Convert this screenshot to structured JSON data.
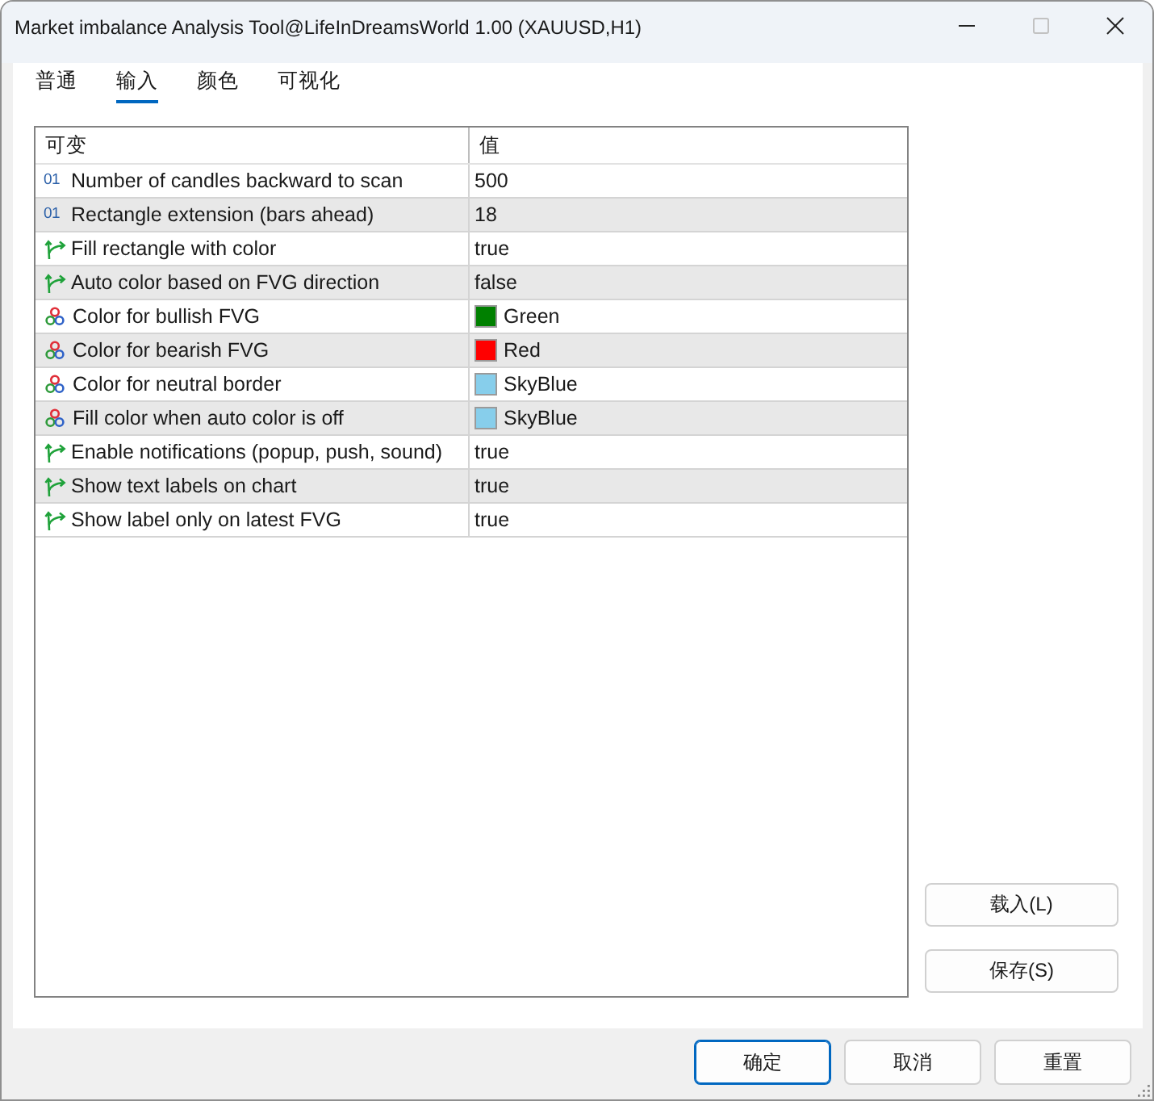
{
  "window": {
    "title": "Market imbalance Analysis Tool@LifeInDreamsWorld 1.00 (XAUUSD,H1)",
    "controls": [
      {
        "kind": "minimize",
        "disabled": false
      },
      {
        "kind": "maximize",
        "disabled": true
      },
      {
        "kind": "close",
        "disabled": false
      }
    ]
  },
  "tabs": [
    {
      "label": "普通",
      "selected": false
    },
    {
      "label": "输入",
      "selected": true
    },
    {
      "label": "颜色",
      "selected": false
    },
    {
      "label": "可视化",
      "selected": false
    }
  ],
  "table": {
    "columns": [
      "可变",
      "值"
    ],
    "rows": [
      {
        "kind": "int",
        "icon_text": "01",
        "name": "Number of candles backward to scan",
        "value": "500"
      },
      {
        "kind": "int",
        "icon_text": "01",
        "name": "Rectangle extension (bars ahead)",
        "value": "18"
      },
      {
        "kind": "bool",
        "name": "Fill rectangle with color",
        "value": "true"
      },
      {
        "kind": "bool",
        "name": "Auto color based on FVG direction",
        "value": "false"
      },
      {
        "kind": "color",
        "name": "Color for bullish FVG",
        "value": "Green",
        "color": "#008000"
      },
      {
        "kind": "color",
        "name": "Color for bearish FVG",
        "value": "Red",
        "color": "#ff0000"
      },
      {
        "kind": "color",
        "name": "Color for neutral border",
        "value": "SkyBlue",
        "color": "#87ceeb"
      },
      {
        "kind": "color",
        "name": "Fill color when auto color is off",
        "value": "SkyBlue",
        "color": "#87ceeb"
      },
      {
        "kind": "bool",
        "name": "Enable notifications (popup, push, sound)",
        "value": "true"
      },
      {
        "kind": "bool",
        "name": "Show text labels on chart",
        "value": "true"
      },
      {
        "kind": "bool",
        "name": "Show label only on latest FVG",
        "value": "true"
      }
    ]
  },
  "side_buttons": [
    "载入(L)",
    "保存(S)"
  ],
  "dialog_buttons": [
    {
      "label": "确定",
      "default": true
    },
    {
      "label": "取消",
      "default": false
    },
    {
      "label": "重置",
      "default": false
    }
  ]
}
